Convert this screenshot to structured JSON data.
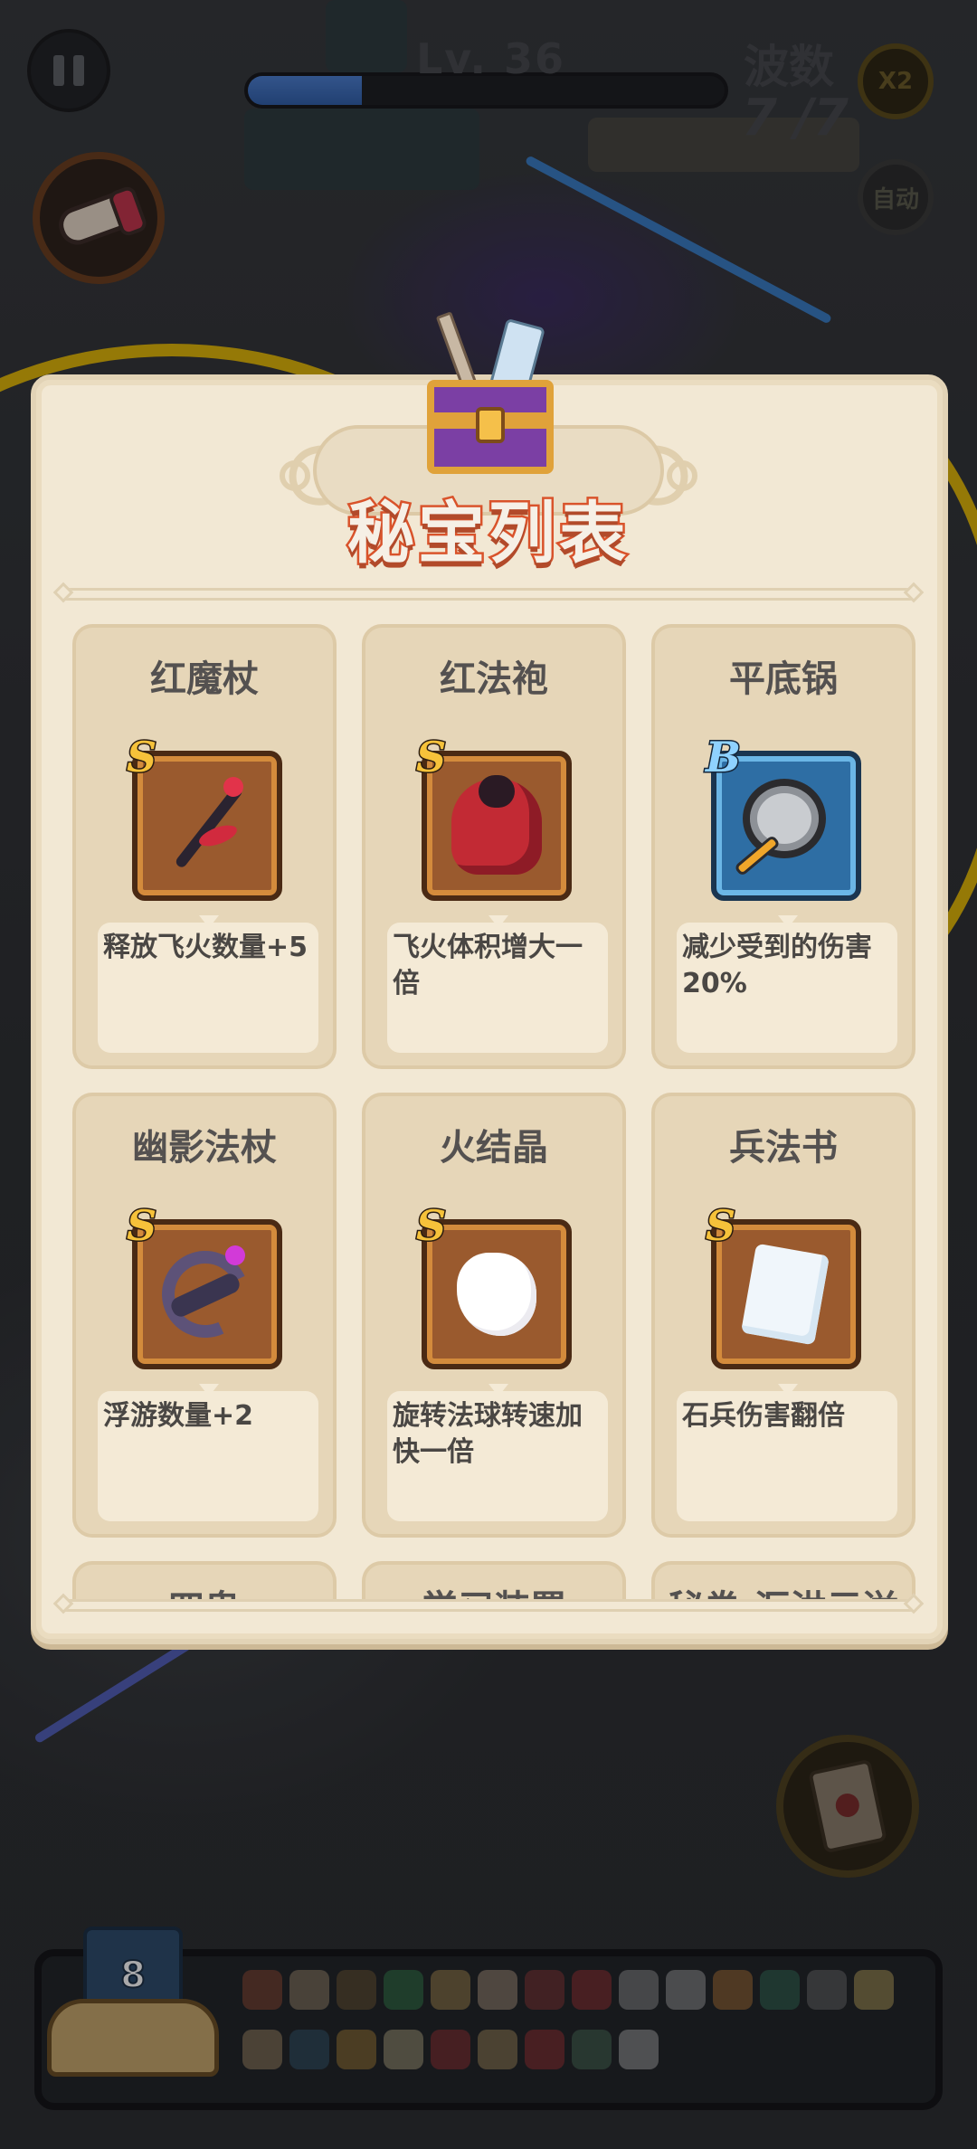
{
  "hud": {
    "level_label": "Lv. 36",
    "level_progress": 0.24,
    "wave_label": "波数",
    "wave_value": "7 /7",
    "speed_label": "X2",
    "auto_label": "自动"
  },
  "panel": {
    "title": "秘宝列表",
    "items": [
      {
        "name": "红魔杖",
        "rank": "S",
        "art": "staff",
        "desc": "释放飞火数量+5"
      },
      {
        "name": "红法袍",
        "rank": "S",
        "art": "robe",
        "desc": "飞火体积增大一倍"
      },
      {
        "name": "平底锅",
        "rank": "B",
        "art": "pan",
        "desc": "减少受到的伤害20%"
      },
      {
        "name": "幽影法杖",
        "rank": "S",
        "art": "ghost",
        "desc": "浮游数量+2"
      },
      {
        "name": "火结晶",
        "rank": "S",
        "art": "crystal",
        "desc": "旋转法球转速加快一倍"
      },
      {
        "name": "兵法书",
        "rank": "S",
        "art": "book",
        "desc": "石兵伤害翻倍"
      }
    ],
    "peek_items": [
      "四鬼",
      "学习装置",
      "秘卷·汇洪元溢"
    ]
  },
  "inventory": {
    "count": "8",
    "icons": [
      "#b85a3a",
      "#c9b28a",
      "#8a6a3a",
      "#3aa05a",
      "#d8b060",
      "#e0c0a0",
      "#b04040",
      "#c83a3a",
      "#c0c0c0",
      "#d0d0d0",
      "#e09040",
      "#3a8a6a",
      "#8a8a8a",
      "#f0d070",
      "#d0b080",
      "#3a6a8a",
      "#d0a040",
      "#e0d0a0",
      "#c03a3a",
      "#d0b070",
      "#c83a3a",
      "#5a8a6a",
      "#e0e0e0"
    ]
  }
}
